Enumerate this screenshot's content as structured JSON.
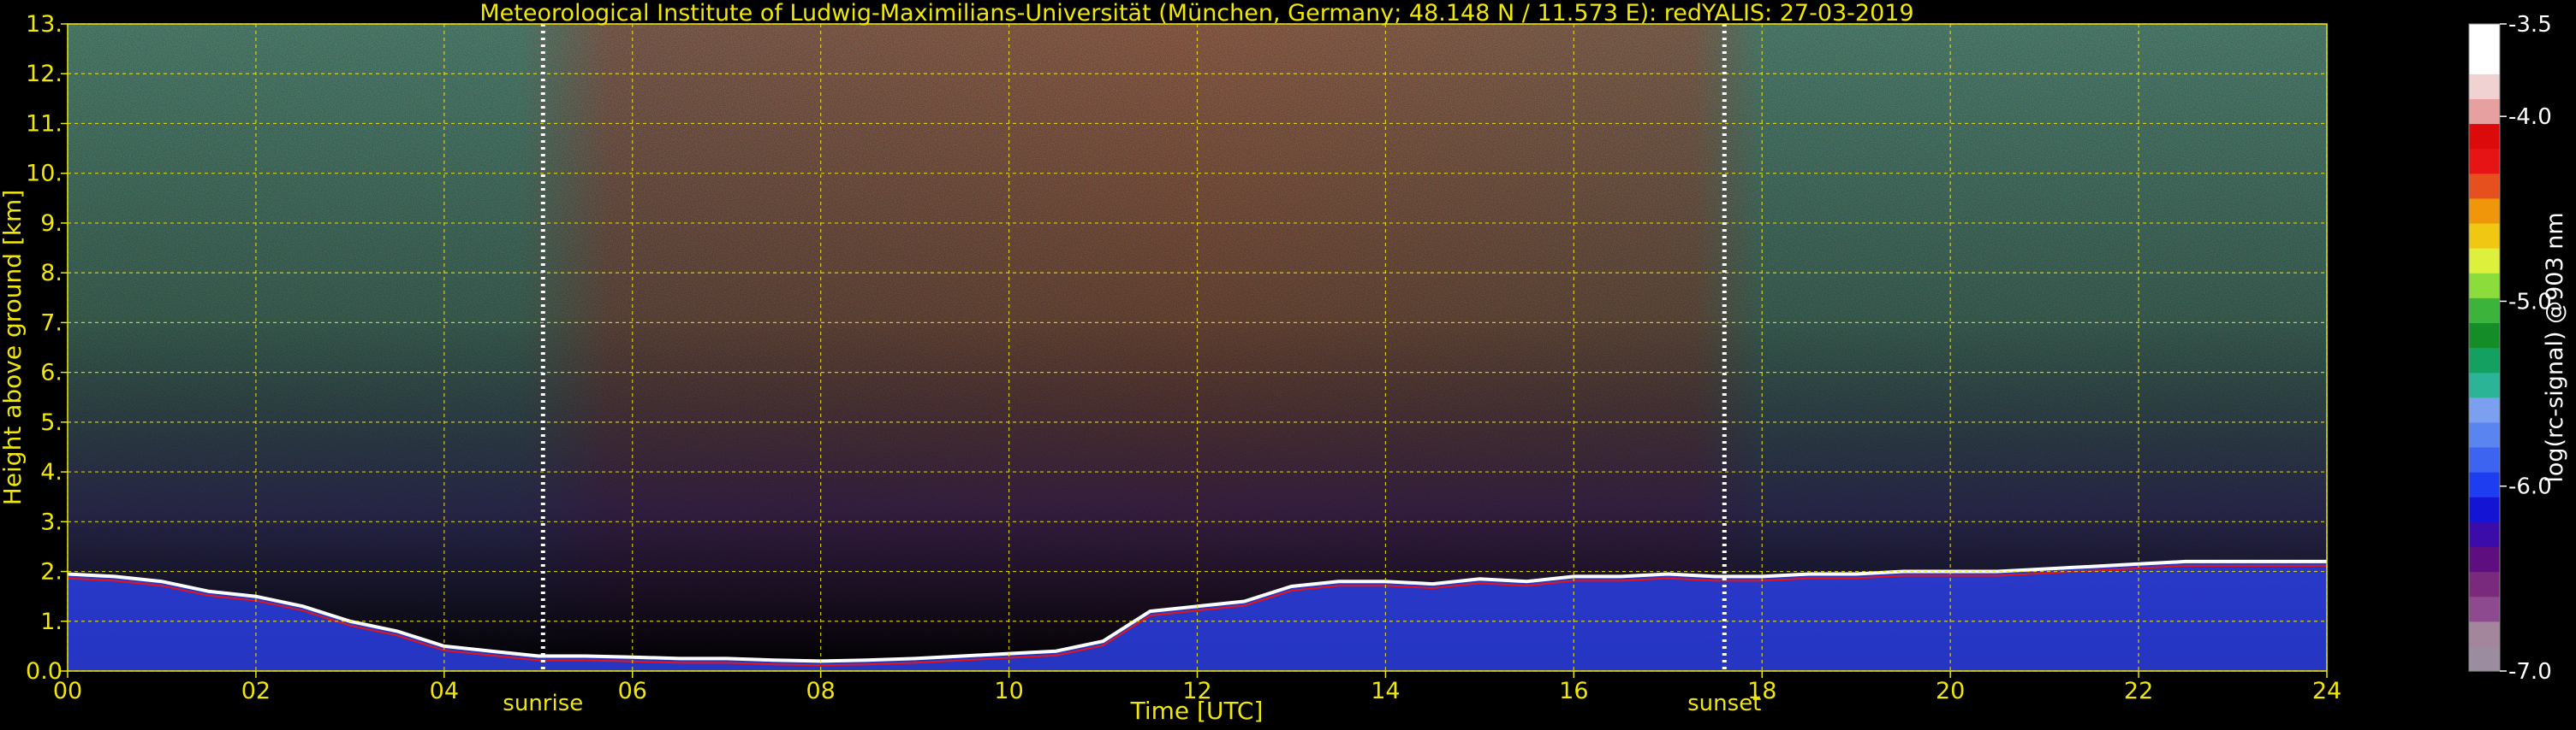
{
  "chart_data": {
    "type": "heatmap",
    "title": "Meteorological Institute of Ludwig-Maximilians-Universität (München, Germany; 48.148 N / 11.573 E):    redYALIS: 27-03-2019",
    "xlabel": "Time [UTC]",
    "ylabel": "Height above ground [km]",
    "xlim": [
      0,
      24
    ],
    "ylim": [
      0,
      13
    ],
    "xticks": [
      "00",
      "02",
      "04",
      "06",
      "08",
      "10",
      "12",
      "14",
      "16",
      "18",
      "20",
      "22",
      "24"
    ],
    "yticks": [
      "0.0",
      "1.",
      "2.",
      "3.",
      "4.",
      "5.",
      "6.",
      "7.",
      "8.",
      "9.",
      "10.",
      "11.",
      "12.",
      "13."
    ],
    "grid": true,
    "annotations": [
      {
        "label": "sunrise",
        "time": 5.05
      },
      {
        "label": "sunset",
        "time": 17.6
      }
    ],
    "boundary_layer_top": {
      "times": [
        0,
        0.5,
        1,
        1.5,
        2,
        2.5,
        3,
        3.5,
        4,
        4.5,
        5,
        5.5,
        6,
        6.5,
        7,
        7.5,
        8,
        8.5,
        9,
        9.5,
        10,
        10.5,
        11,
        11.5,
        12,
        12.5,
        13,
        13.5,
        14,
        14.5,
        15,
        15.5,
        16,
        16.5,
        17,
        17.5,
        18,
        18.5,
        19,
        19.5,
        20,
        20.5,
        21,
        21.5,
        22,
        22.5,
        23,
        23.5,
        24
      ],
      "heights": [
        1.95,
        1.9,
        1.8,
        1.6,
        1.5,
        1.3,
        1.0,
        0.8,
        0.5,
        0.4,
        0.3,
        0.3,
        0.28,
        0.25,
        0.25,
        0.22,
        0.2,
        0.22,
        0.25,
        0.3,
        0.35,
        0.4,
        0.6,
        1.2,
        1.3,
        1.4,
        1.7,
        1.8,
        1.8,
        1.75,
        1.85,
        1.8,
        1.9,
        1.9,
        1.95,
        1.9,
        1.9,
        1.95,
        1.95,
        2.0,
        2.0,
        2.0,
        2.05,
        2.1,
        2.15,
        2.2,
        2.2,
        2.2,
        2.2
      ]
    },
    "colorbar": {
      "label": "log(rc-signal) @903 nm",
      "ticks": [
        "-3.5",
        "-4.0",
        "-5.0",
        "-6.0",
        "-7.0"
      ],
      "tick_values": [
        -3.5,
        -4.0,
        -5.0,
        -6.0,
        -7.0
      ],
      "range": [
        -7.0,
        -3.5
      ],
      "colors": [
        "#9c8ca0",
        "#a4869c",
        "#8e4a8e",
        "#7a2a7a",
        "#5e0e7e",
        "#3c0caa",
        "#1414d4",
        "#1e3cf0",
        "#3c64f0",
        "#5a84f0",
        "#7ca0f0",
        "#2cb496",
        "#14a060",
        "#148c28",
        "#3cb43c",
        "#8cdc3c",
        "#dcf03c",
        "#f0c814",
        "#f0960a",
        "#e6501e",
        "#e61414",
        "#dc0a0a",
        "#e6a0a0",
        "#f0d2d2",
        "#ffffff",
        "#ffffff"
      ]
    }
  }
}
